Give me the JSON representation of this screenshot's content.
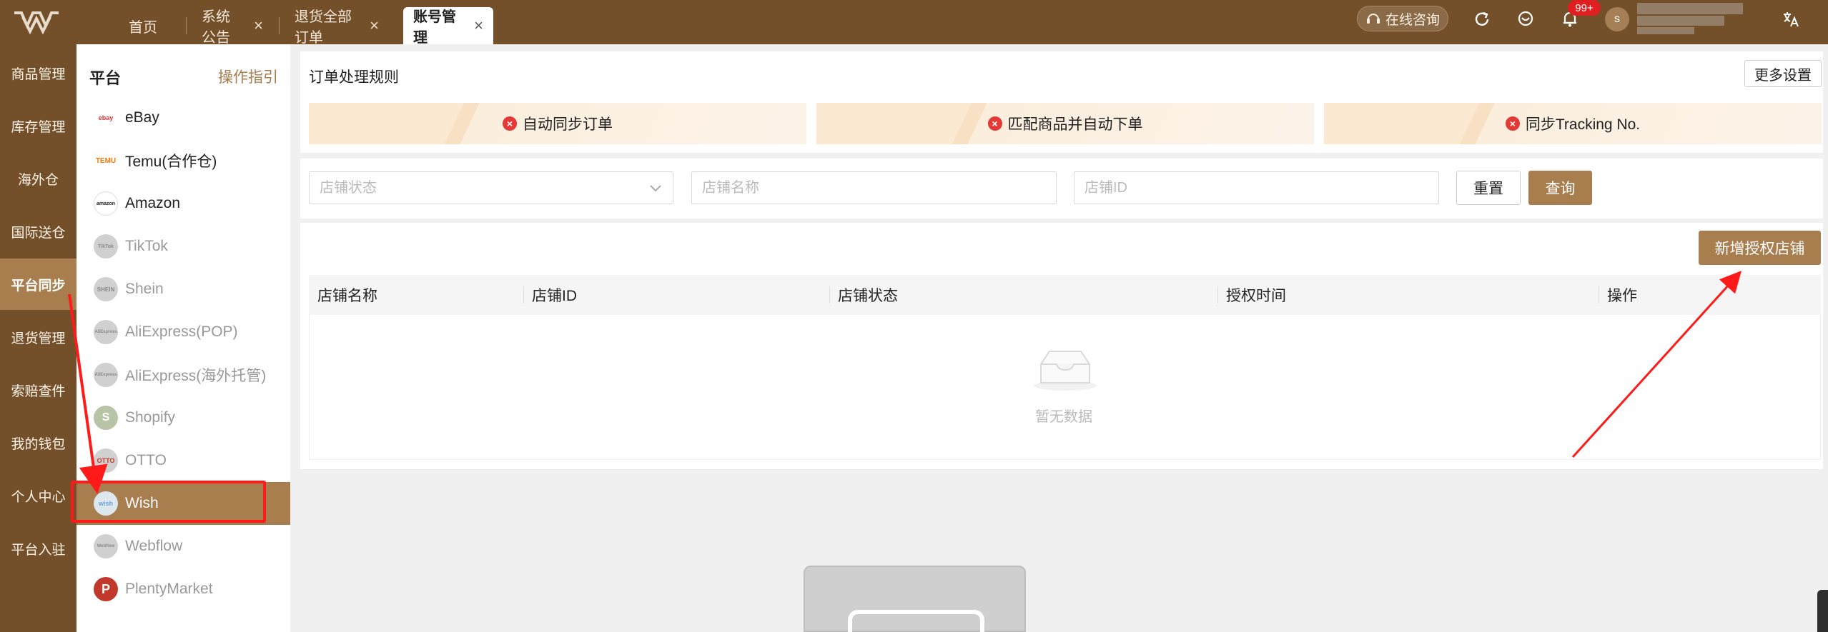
{
  "header": {
    "tabs": [
      {
        "label": "首页",
        "closable": false,
        "active": false
      },
      {
        "label": "系统公告",
        "closable": true,
        "active": false
      },
      {
        "label": "退货全部订单",
        "closable": true,
        "active": false
      },
      {
        "label": "账号管理",
        "closable": true,
        "active": true
      }
    ],
    "close_glyph": "×",
    "consult_label": "在线咨询",
    "notification_badge": "99+",
    "avatar_initial": "s",
    "icons": [
      "logo-icon",
      "headset-icon",
      "refresh-icon",
      "location-icon",
      "bell-icon",
      "translate-icon"
    ]
  },
  "sidebar": {
    "items": [
      {
        "label": "商品管理",
        "active": false
      },
      {
        "label": "库存管理",
        "active": false
      },
      {
        "label": "海外仓",
        "active": false
      },
      {
        "label": "国际送仓",
        "active": false
      },
      {
        "label": "平台同步",
        "active": true
      },
      {
        "label": "退货管理",
        "active": false
      },
      {
        "label": "索赔查件",
        "active": false
      },
      {
        "label": "我的钱包",
        "active": false
      },
      {
        "label": "个人中心",
        "active": false
      },
      {
        "label": "平台入驻",
        "active": false
      }
    ]
  },
  "platform_panel": {
    "title": "平台",
    "guide_link": "操作指引",
    "items": [
      {
        "label": "eBay",
        "icon": "ebay-logo",
        "icon_text": "ebay",
        "enabled": true,
        "selected": false
      },
      {
        "label": "Temu(合作仓)",
        "icon": "temu-logo",
        "icon_text": "TEMU",
        "enabled": true,
        "selected": false
      },
      {
        "label": "Amazon",
        "icon": "amazon-logo",
        "icon_text": "amazon",
        "enabled": true,
        "selected": false
      },
      {
        "label": "TikTok",
        "icon": "tiktok-logo",
        "icon_text": "TikTok",
        "enabled": false,
        "selected": false
      },
      {
        "label": "Shein",
        "icon": "shein-logo",
        "icon_text": "SHEIN",
        "enabled": false,
        "selected": false
      },
      {
        "label": "AliExpress(POP)",
        "icon": "aliexpress-logo",
        "icon_text": "AliExpress",
        "enabled": false,
        "selected": false
      },
      {
        "label": "AliExpress(海外托管)",
        "icon": "aliexpress-logo",
        "icon_text": "AliExpress",
        "enabled": false,
        "selected": false
      },
      {
        "label": "Shopify",
        "icon": "shopify-logo",
        "icon_text": "S",
        "enabled": false,
        "selected": false
      },
      {
        "label": "OTTO",
        "icon": "otto-logo",
        "icon_text": "OTTO",
        "enabled": false,
        "selected": false
      },
      {
        "label": "Wish",
        "icon": "wish-logo",
        "icon_text": "wish",
        "enabled": true,
        "selected": true
      },
      {
        "label": "Webflow",
        "icon": "webflow-logo",
        "icon_text": "Webflow",
        "enabled": false,
        "selected": false
      },
      {
        "label": "PlentyMarket",
        "icon": "plentymarket-logo",
        "icon_text": "P",
        "enabled": false,
        "selected": false
      }
    ]
  },
  "rules": {
    "title": "订单处理规则",
    "more_settings": "更多设置",
    "items": [
      {
        "label": "自动同步订单",
        "status": "disabled"
      },
      {
        "label": "匹配商品并自动下单",
        "status": "disabled"
      },
      {
        "label": "同步Tracking No.",
        "status": "disabled"
      }
    ]
  },
  "filters": {
    "status_placeholder": "店铺状态",
    "name_placeholder": "店铺名称",
    "id_placeholder": "店铺ID",
    "reset_label": "重置",
    "query_label": "查询"
  },
  "add_store_label": "新增授权店铺",
  "table": {
    "columns": [
      "店铺名称",
      "店铺ID",
      "店铺状态",
      "授权时间",
      "操作"
    ],
    "rows": [],
    "empty_text": "暂无数据"
  },
  "colors": {
    "brand_dark": "#74502a",
    "brand_accent": "#a97e4f",
    "error_red": "#e53935",
    "annotation_red": "#ff1a1a"
  }
}
